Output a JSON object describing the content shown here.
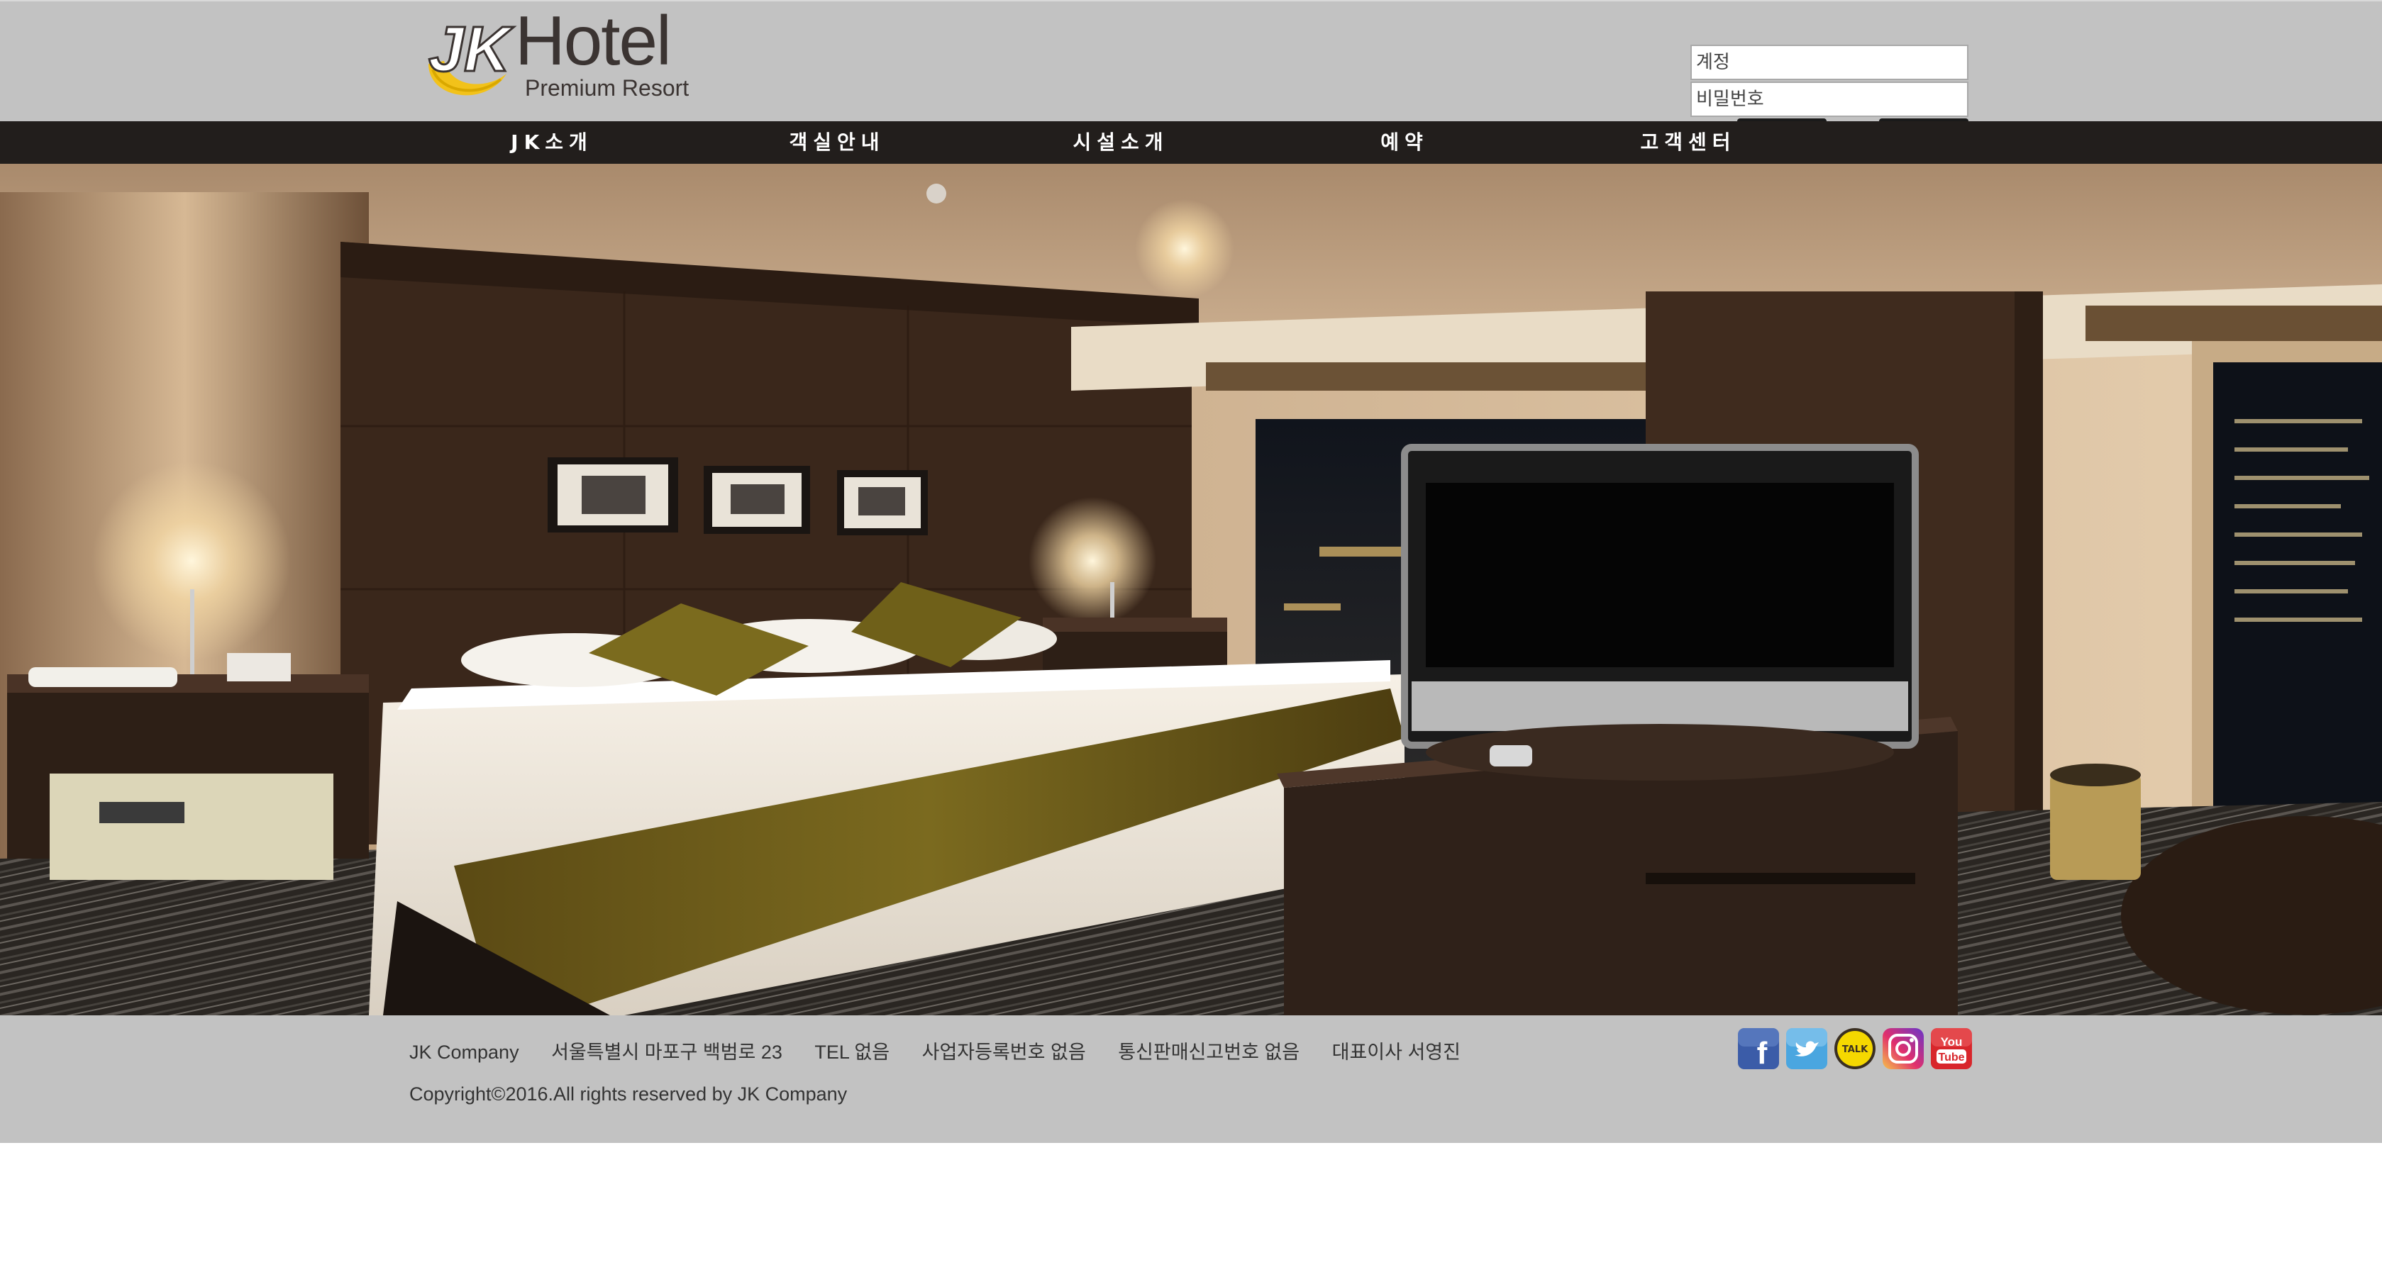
{
  "header": {
    "logo_mark": "JK",
    "logo_title": "Hotel",
    "logo_subtitle": "Premium Resort",
    "login": {
      "account_placeholder": "계정",
      "password_placeholder": "비밀번호"
    }
  },
  "nav": {
    "items": [
      {
        "label": "JK소개"
      },
      {
        "label": "객실안내"
      },
      {
        "label": "시설소개"
      },
      {
        "label": "예약"
      },
      {
        "label": "고객센터"
      }
    ]
  },
  "hero": {
    "image_subject": "hotel-room-photo"
  },
  "footer": {
    "info": [
      "JK Company",
      "서울특별시 마포구 백범로 23",
      "TEL 없음",
      "사업자등록번호 없음",
      "통신판매신고번호 없음",
      "대표이사 서영진"
    ],
    "copyright": "Copyright©2016.All rights reserved by JK Company",
    "social": [
      {
        "icon": "facebook-icon",
        "color": "#3b5ca8"
      },
      {
        "icon": "twitter-icon",
        "color": "#4aa6e0"
      },
      {
        "icon": "kakaotalk-icon",
        "color": "#f5d800",
        "text": "TALK"
      },
      {
        "icon": "instagram-icon",
        "color": "#c13584"
      },
      {
        "icon": "youtube-icon",
        "color": "#d8262b",
        "text": "You Tube"
      }
    ]
  },
  "colors": {
    "header_bg": "#c2c2c2",
    "nav_bg": "#221e1c",
    "logo_accent": "#f2c21a",
    "text": "#333333"
  }
}
